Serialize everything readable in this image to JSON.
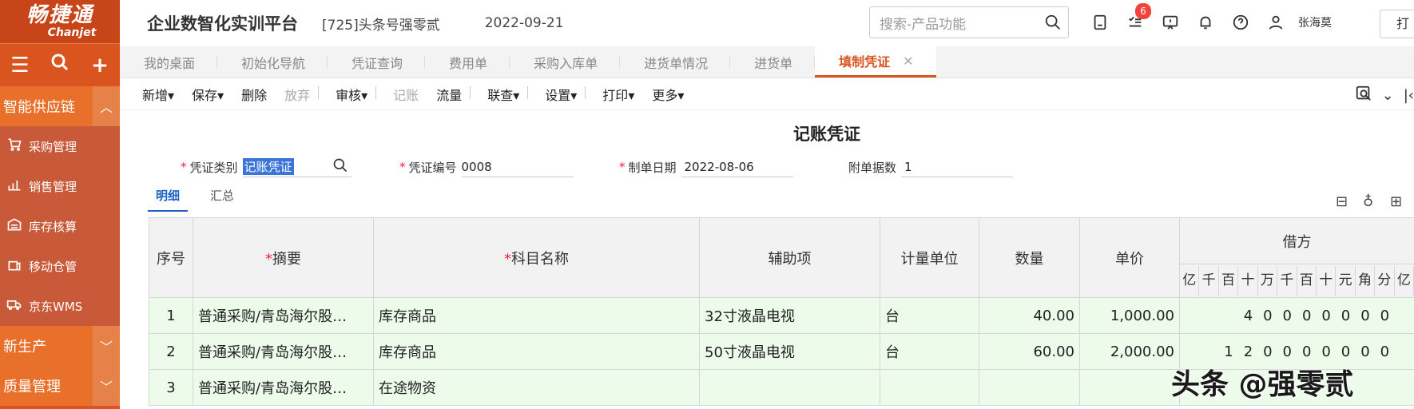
{
  "sidebar": {
    "logo_cn": "畅捷通",
    "logo_en": "Chanjet",
    "group1": "智能供应链",
    "items": [
      {
        "label": "采购管理"
      },
      {
        "label": "销售管理"
      },
      {
        "label": "库存核算"
      },
      {
        "label": "移动仓管"
      },
      {
        "label": "京东WMS"
      }
    ],
    "group2": "新生产",
    "group3": "质量管理"
  },
  "header": {
    "title": "企业数智化实训平台",
    "account": "[725]头条号强零贰",
    "date": "2022-09-21",
    "search_placeholder": "搜索-产品功能",
    "badge": "6",
    "user": "张海莫",
    "print_label": "打"
  },
  "tabs": [
    "我的桌面",
    "初始化导航",
    "凭证查询",
    "费用单",
    "采购入库单",
    "进货单情况",
    "进货单",
    "填制凭证"
  ],
  "toolbar": {
    "items": [
      "新增",
      "保存",
      "删除",
      "放弃",
      "审核",
      "记账",
      "流量",
      "联查",
      "设置",
      "打印",
      "更多"
    ]
  },
  "voucher": {
    "title": "记账凭证",
    "type_label": "凭证类别",
    "type_value": "记账凭证",
    "no_label": "凭证编号",
    "no_value": "0008",
    "date_label": "制单日期",
    "date_value": "2022-08-06",
    "attach_label": "附单据数",
    "attach_value": "1"
  },
  "subtabs": [
    "明细",
    "汇总"
  ],
  "table": {
    "headers": {
      "seq": "序号",
      "summary": "摘要",
      "account": "科目名称",
      "aux": "辅助项",
      "unit": "计量单位",
      "qty": "数量",
      "price": "单价",
      "debit": "借方"
    },
    "digit_headers": [
      "亿",
      "千",
      "百",
      "十",
      "万",
      "千",
      "百",
      "十",
      "元",
      "角",
      "分",
      "亿"
    ],
    "rows": [
      {
        "seq": "1",
        "summary": "普通采购/青岛海尔股…",
        "account": "库存商品",
        "aux": "32寸液晶电视",
        "unit": "台",
        "qty": "40.00",
        "price": "1,000.00",
        "debit": "40000000"
      },
      {
        "seq": "2",
        "summary": "普通采购/青岛海尔股…",
        "account": "库存商品",
        "aux": "50寸液晶电视",
        "unit": "台",
        "qty": "60.00",
        "price": "2,000.00",
        "debit": "120000000"
      },
      {
        "seq": "3",
        "summary": "普通采购/青岛海尔股…",
        "account": "在途物资",
        "aux": "",
        "unit": "",
        "qty": "",
        "price": "",
        "debit": ""
      }
    ]
  },
  "watermark": "头条 @强零贰"
}
